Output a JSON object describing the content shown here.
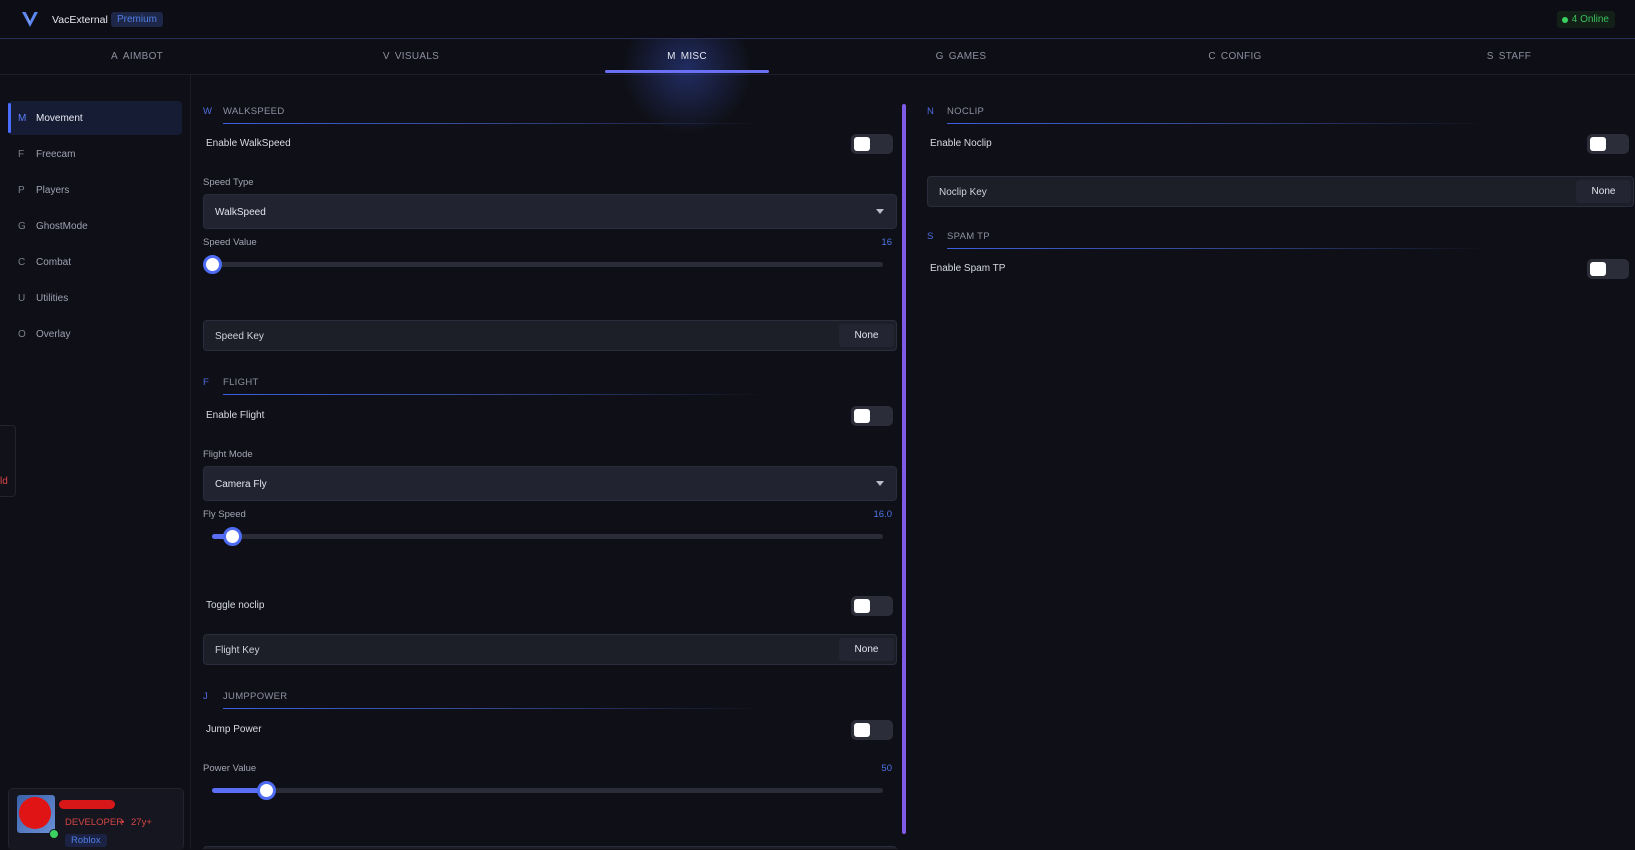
{
  "app": {
    "title": "VacExternal",
    "badge": "Premium",
    "online": "4 Online",
    "accent": "#4a6dff"
  },
  "tabs": [
    {
      "key": "A",
      "label": "AIMBOT"
    },
    {
      "key": "V",
      "label": "VISUALS"
    },
    {
      "key": "M",
      "label": "MISC",
      "active": true
    },
    {
      "key": "G",
      "label": "GAMES"
    },
    {
      "key": "C",
      "label": "CONFIG"
    },
    {
      "key": "S",
      "label": "STAFF"
    }
  ],
  "sidebar": {
    "items": [
      {
        "key": "M",
        "label": "Movement",
        "active": true
      },
      {
        "key": "F",
        "label": "Freecam"
      },
      {
        "key": "P",
        "label": "Players"
      },
      {
        "key": "G",
        "label": "GhostMode"
      },
      {
        "key": "C",
        "label": "Combat"
      },
      {
        "key": "U",
        "label": "Utilities"
      },
      {
        "key": "O",
        "label": "Overlay"
      }
    ],
    "edge_text": "ld"
  },
  "profile": {
    "role": "DEVELOPER",
    "separator": "•",
    "age": "27y+",
    "platform": "Roblox"
  },
  "walkspeed": {
    "key": "W",
    "title": "WALKSPEED",
    "enable_label": "Enable WalkSpeed",
    "enabled": false,
    "type_label": "Speed Type",
    "type_value": "WalkSpeed",
    "value_label": "Speed Value",
    "value": "16",
    "value_fraction": 0.0,
    "keybind_label": "Speed Key",
    "keybind_value": "None"
  },
  "flight": {
    "key": "F",
    "title": "FLIGHT",
    "enable_label": "Enable Flight",
    "enabled": false,
    "mode_label": "Flight Mode",
    "mode_value": "Camera Fly",
    "speed_label": "Fly Speed",
    "speed_value": "16.0",
    "speed_fraction": 0.03,
    "noclip_label": "Toggle noclip",
    "noclip_enabled": false,
    "keybind_label": "Flight Key",
    "keybind_value": "None"
  },
  "jumppower": {
    "key": "J",
    "title": "JUMPPOWER",
    "enable_label": "Jump Power",
    "enabled": false,
    "value_label": "Power Value",
    "value": "50",
    "value_fraction": 0.08
  },
  "noclip": {
    "key": "N",
    "title": "NOCLIP",
    "enable_label": "Enable Noclip",
    "enabled": false,
    "keybind_label": "Noclip Key",
    "keybind_value": "None"
  },
  "spam_tp": {
    "key": "S",
    "title": "SPAM TP",
    "enable_label": "Enable Spam TP",
    "enabled": false
  }
}
